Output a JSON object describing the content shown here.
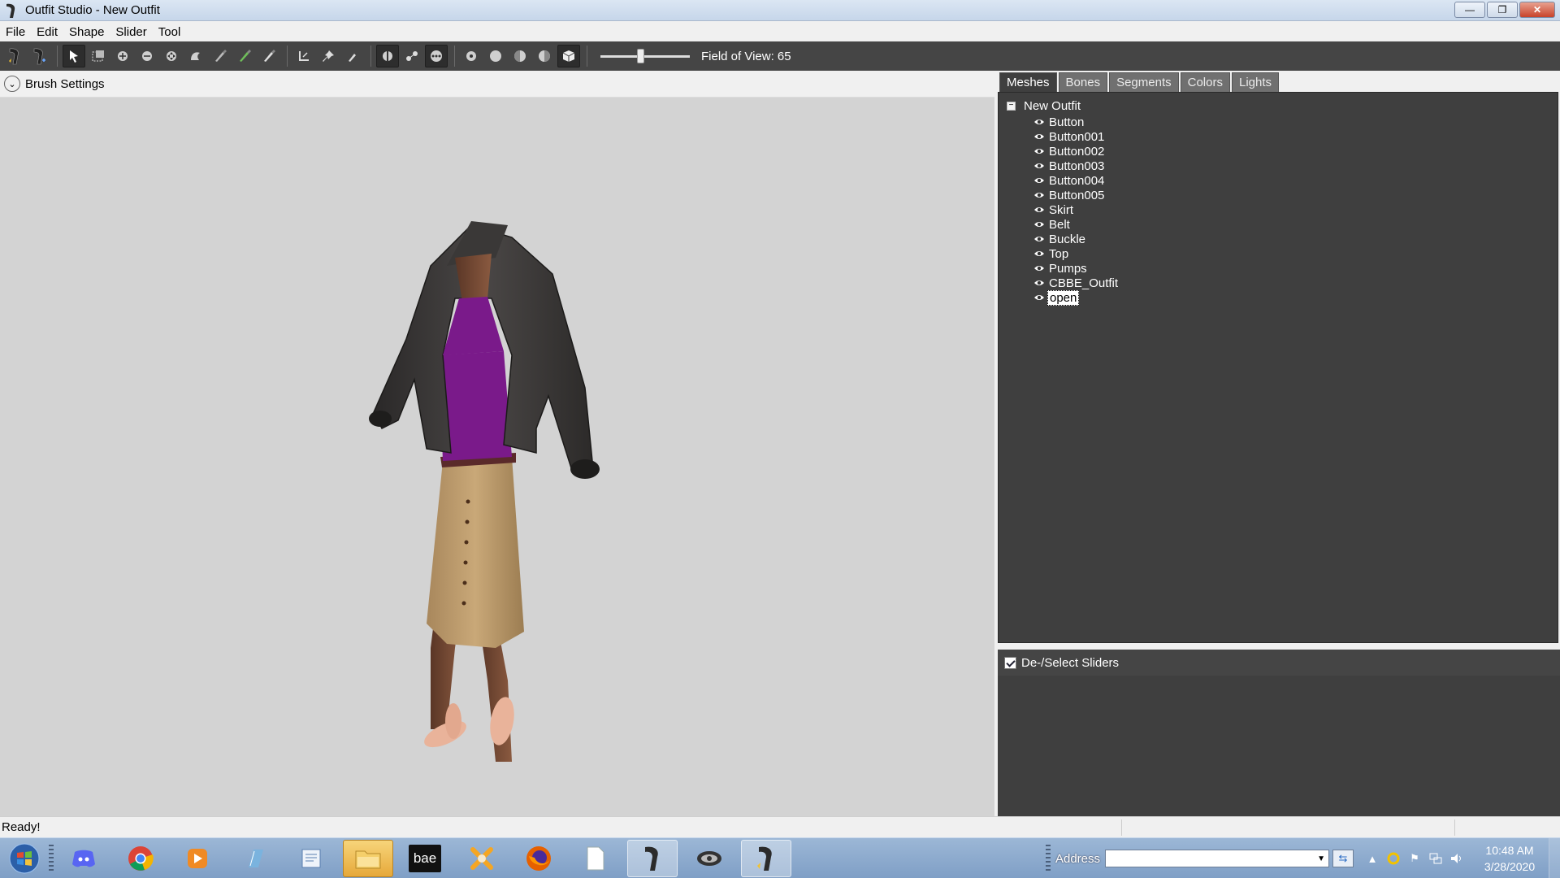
{
  "window": {
    "title": "Outfit Studio - New Outfit",
    "controls": {
      "minimize": "—",
      "restore": "❐",
      "close": "✕"
    }
  },
  "menu": [
    "File",
    "Edit",
    "Shape",
    "Slider",
    "Tool"
  ],
  "toolbar": {
    "fov_label": "Field of View: 65",
    "fov_slider_fraction": 0.45,
    "tools": [
      "select-tool",
      "transform-tool",
      "inflate-brush",
      "deflate-brush",
      "move-brush",
      "smooth-brush",
      "mask-brush",
      "weight-brush",
      "color-brush",
      "anchor-tool",
      "pin-tool",
      "edit-tool"
    ]
  },
  "brush_settings": {
    "label": "Brush Settings"
  },
  "tabs": [
    "Meshes",
    "Bones",
    "Segments",
    "Colors",
    "Lights"
  ],
  "active_tab": "Meshes",
  "tree": {
    "root": "New Outfit",
    "expander": "−",
    "items": [
      "Button",
      "Button001",
      "Button002",
      "Button003",
      "Button004",
      "Button005",
      "Skirt",
      "Belt",
      "Buckle",
      "Top",
      "Pumps",
      "CBBE_Outfit",
      "open"
    ],
    "selected": "open"
  },
  "deselect": {
    "label": "De-/Select Sliders",
    "checked": true
  },
  "status": {
    "text": "Ready!"
  },
  "taskbar": {
    "apps": [
      "discord",
      "chrome",
      "media-player",
      "notepad",
      "text-editor",
      "file-explorer",
      "bae",
      "blender",
      "firefox",
      "blank-doc",
      "outfit-studio",
      "creation-kit",
      "outfit-studio-2"
    ],
    "bae_label": "bae",
    "address_label": "Address",
    "time": "10:48 AM",
    "date": "3/28/2020"
  },
  "colors": {
    "toolbar_bg": "#454545",
    "panel_bg": "#3f3f3f",
    "viewport_bg": "#d3d3d3",
    "accent": "#4a78b8"
  }
}
